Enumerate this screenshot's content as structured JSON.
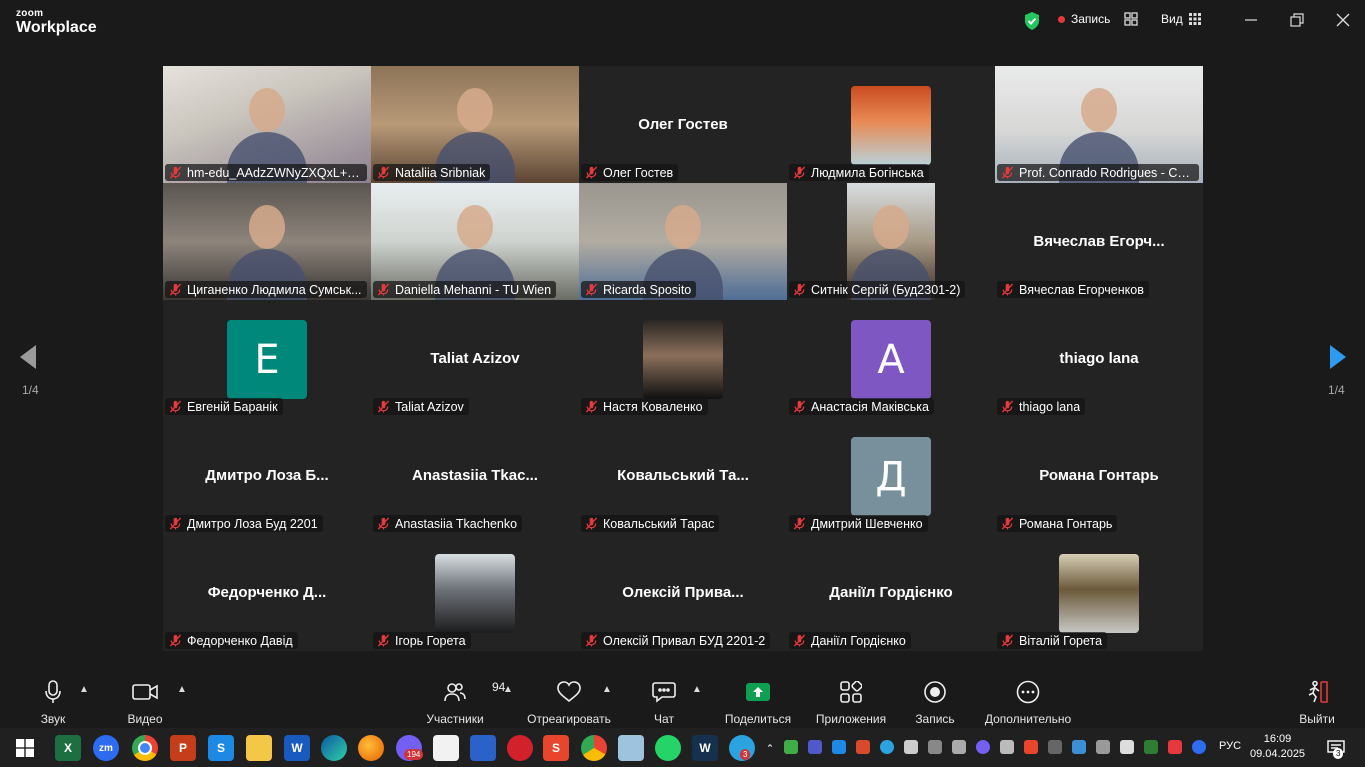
{
  "app": {
    "logo_line1": "zoom",
    "logo_line2": "Workplace"
  },
  "titlebar": {
    "record_label": "Запись",
    "view_label": "Вид"
  },
  "pager": {
    "left": "1/4",
    "right": "1/4"
  },
  "participants": [
    {
      "label": "hm-edu_AAdzZWNyZXQxL+2hayf...",
      "display": "video",
      "speaking": false
    },
    {
      "label": "Nataliia Sribniak",
      "display": "video",
      "speaking": false
    },
    {
      "label": "Олег Гостев",
      "display": "name",
      "big_name": "Олег Гостев",
      "speaking": false
    },
    {
      "label": "Людмила Богінська",
      "display": "photo",
      "speaking": false
    },
    {
      "label": "Prof. Conrado Rodrigues - CEFE...",
      "display": "video",
      "speaking": true
    },
    {
      "label": "Циганенко Людмила Сумськ...",
      "display": "video",
      "speaking": false
    },
    {
      "label": "Daniella Mehanni - TU Wien",
      "display": "video",
      "speaking": false
    },
    {
      "label": "Ricarda Sposito",
      "display": "video",
      "speaking": false
    },
    {
      "label": "Ситнік Сергій (Буд2301-2)",
      "display": "video",
      "speaking": false
    },
    {
      "label": "Вячеслав Егорченков",
      "display": "name",
      "big_name": "Вячеслав Егорч...",
      "speaking": false
    },
    {
      "label": "Евгеній Баранік",
      "display": "avatar",
      "avatar_letter": "E",
      "avatar_color": "#00897b",
      "speaking": false
    },
    {
      "label": "Taliat Azizov",
      "display": "name",
      "big_name": "Taliat Azizov",
      "speaking": false
    },
    {
      "label": "Настя Коваленко",
      "display": "photo",
      "speaking": false
    },
    {
      "label": "Анастасія Маківська",
      "display": "avatar",
      "avatar_letter": "A",
      "avatar_color": "#7e57c2",
      "speaking": false
    },
    {
      "label": "thiago lana",
      "display": "name",
      "big_name": "thiago lana",
      "speaking": false
    },
    {
      "label": "Дмитро Лоза Буд 2201",
      "display": "name",
      "big_name": "Дмитро Лоза Б...",
      "speaking": false
    },
    {
      "label": "Anastasiia Tkachenko",
      "display": "name",
      "big_name": "Anastasiia Tkac...",
      "speaking": false
    },
    {
      "label": "Ковальський Тарас",
      "display": "name",
      "big_name": "Ковальський Та...",
      "speaking": false
    },
    {
      "label": "Дмитрий Шевченко",
      "display": "avatar",
      "avatar_letter": "Д",
      "avatar_color": "#78909c",
      "speaking": false
    },
    {
      "label": "Романа Гонтарь",
      "display": "name",
      "big_name": "Романа Гонтарь",
      "speaking": false
    },
    {
      "label": "Федорченко Давід",
      "display": "name",
      "big_name": "Федорченко Д...",
      "speaking": false
    },
    {
      "label": "Ігорь Горета",
      "display": "photo",
      "speaking": false
    },
    {
      "label": "Олексій Привал БУД 2201-2",
      "display": "name",
      "big_name": "Олексій Прива...",
      "speaking": false
    },
    {
      "label": "Даніїл Гордієнко",
      "display": "name",
      "big_name": "Даніїл Гордієнко",
      "speaking": false
    },
    {
      "label": "Віталій Горета",
      "display": "photo",
      "speaking": false
    }
  ],
  "toolbar": {
    "audio_label": "Звук",
    "video_label": "Видео",
    "participants_label": "Участники",
    "participants_count": "94",
    "react_label": "Отреагировать",
    "chat_label": "Чат",
    "share_label": "Поделиться",
    "apps_label": "Приложения",
    "record_label": "Запись",
    "more_label": "Дополнительно",
    "leave_label": "Выйти",
    "accent_color": "#0e9f50"
  },
  "taskbar": {
    "lang": "РУС",
    "time": "16:09",
    "date": "09.04.2025",
    "viber_badge": "194",
    "telegram_badge": "3",
    "notifications_badge": "3"
  }
}
